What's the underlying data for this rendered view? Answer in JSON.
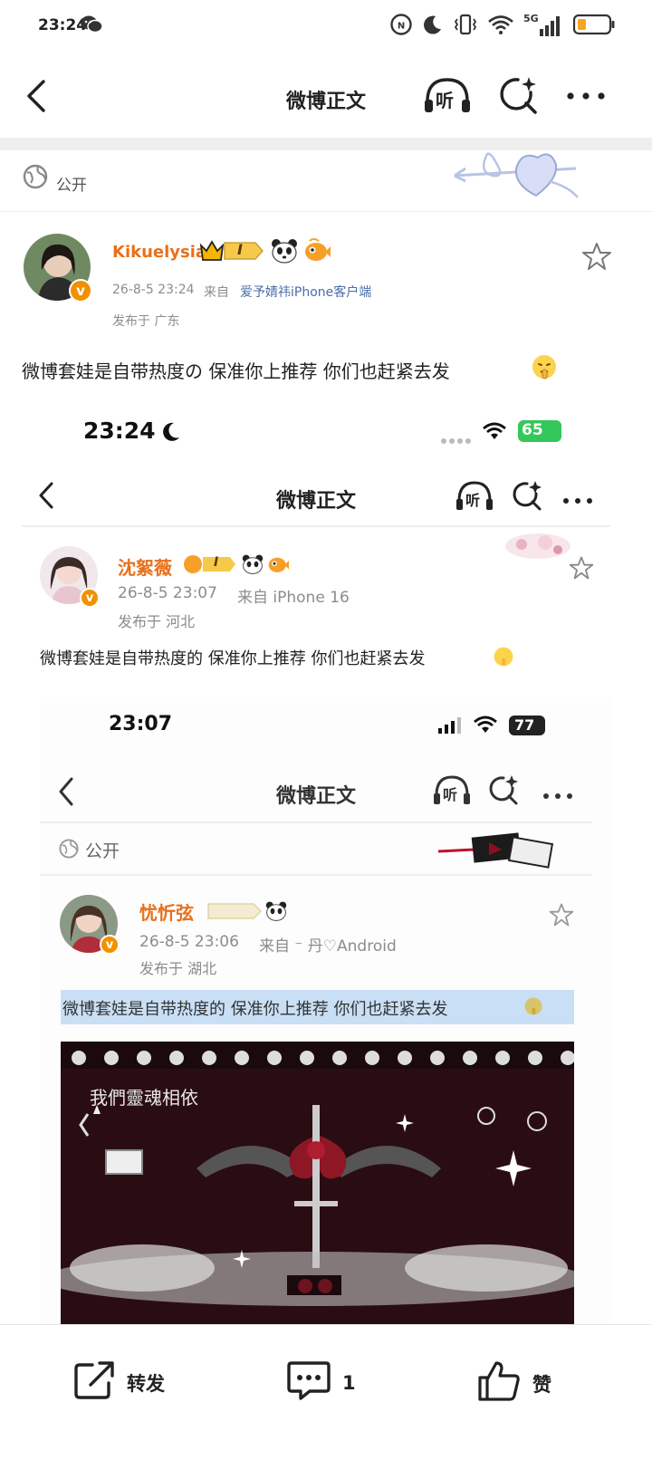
{
  "status_bar": {
    "time": "23:24",
    "network": "5G"
  },
  "nav": {
    "title": "微博正文",
    "listen_label": "听"
  },
  "post": {
    "visibility": "公开",
    "username": "Kikuelysian",
    "level_badge": "I",
    "date": "26-8-5  23:24",
    "source_prefix": "来自",
    "source": "爱予婧祎iPhone客户端",
    "location": "发布于  广东",
    "text": "微博套娃是自带热度の 保准你上推荐 你们也赶紧去发"
  },
  "nested1": {
    "status_time": "23:24",
    "battery": "65",
    "nav_title": "微博正文",
    "listen_label": "听",
    "username": "沈絮薇",
    "level_badge": "I",
    "date": "26-8-5 23:07",
    "source": "来自 iPhone 16",
    "location": "发布于 河北",
    "text": "微博套娃是自带热度的 保准你上推荐 你们也赶紧去发"
  },
  "nested2": {
    "status_time": "23:07",
    "battery": "77",
    "nav_title": "微博正文",
    "listen_label": "听",
    "visibility": "公开",
    "username": "忧忻弦",
    "date": "26-8-5 23:06",
    "source": "来自 ⁻ 丹♡Android",
    "location": "发布于 湖北",
    "text": "微博套娃是自带热度的 保准你上推荐 你们也赶紧去发",
    "art_caption": "我們靈魂相依"
  },
  "bottom_bar": {
    "repost_label": "转发",
    "comment_count": "1",
    "like_label": "赞"
  },
  "colors": {
    "username": "#e8701a",
    "source_link": "#4a6da8",
    "vip_badge": "#f29100",
    "highlight": "#c9dff5"
  }
}
